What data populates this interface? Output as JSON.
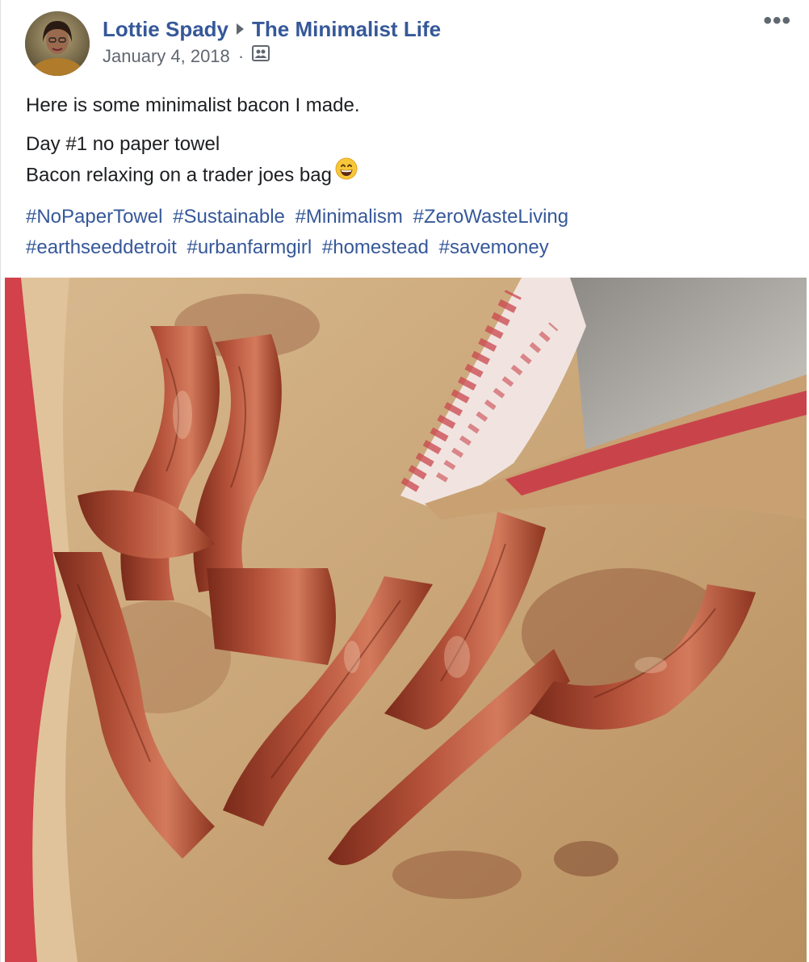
{
  "post": {
    "author": "Lottie Spady",
    "group": "The Minimalist Life",
    "date": "January 4, 2018",
    "separator": "·",
    "privacy_icon": "group-audience-icon",
    "more_icon": "more-options-icon",
    "more_label": "•••",
    "text_line_1": "Here is some minimalist bacon I made.",
    "text_line_2": "Day #1 no paper towel",
    "text_line_3": "Bacon relaxing on a trader joes bag",
    "emoji": "grinning-face-icon",
    "hashtags": [
      "#NoPaperTowel",
      "#Sustainable",
      "#Minimalism",
      "#ZeroWasteLiving",
      "#earthseeddetroit",
      "#urbanfarmgirl",
      "#homestead",
      "#savemoney"
    ],
    "photo_subject": "bacon-on-paper-bag-photo"
  },
  "colors": {
    "link": "#365899",
    "meta": "#616770",
    "text": "#1c1e21"
  }
}
